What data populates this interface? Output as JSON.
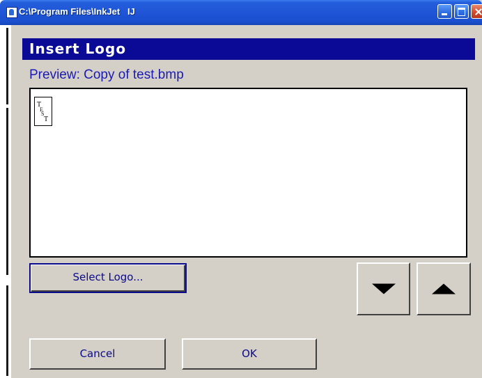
{
  "window": {
    "title": "C:\\Program Files\\InkJet   IJ",
    "minimize_label": "minimize",
    "maximize_label": "maximize",
    "close_label": "close"
  },
  "dialog": {
    "heading": "Insert Logo",
    "preview_label": "Preview:  Copy of test.bmp",
    "logo_thumbnail_text": [
      "T",
      "E",
      "S",
      "T"
    ]
  },
  "buttons": {
    "select_logo": "Select Logo...",
    "cancel": "Cancel",
    "ok": "OK",
    "scroll_down_icon": "triangle-down",
    "scroll_up_icon": "triangle-up"
  },
  "colors": {
    "heading_bg": "#0a0a96",
    "label_text": "#1a1ab4",
    "button_text": "#0a0a8c",
    "dialog_bg": "#d4d0c8"
  }
}
